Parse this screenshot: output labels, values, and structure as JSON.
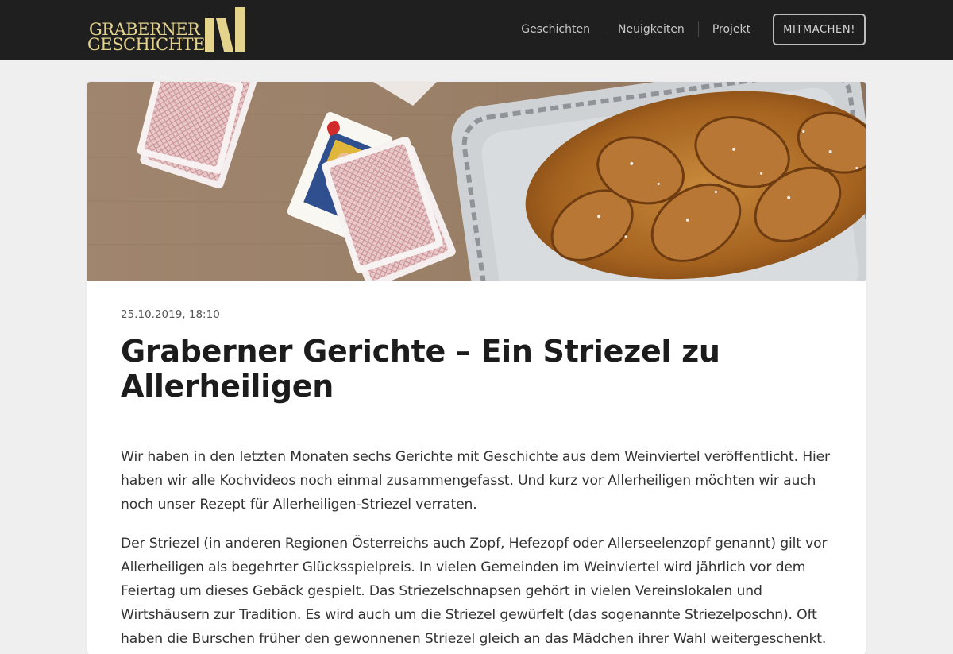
{
  "brand": {
    "line1": "GRABERNER",
    "line2": "GESCHICHTE",
    "color": "#e4d38c"
  },
  "nav": {
    "items": [
      {
        "label": "Geschichten"
      },
      {
        "label": "Neuigkeiten"
      },
      {
        "label": "Projekt"
      }
    ],
    "cta_label": "MITMACHEN!"
  },
  "article": {
    "date": "25.10.2019, 18:10",
    "title": "Graberner Gerichte – Ein Striezel zu Allerheiligen",
    "paragraphs": [
      "Wir haben in den letzten Monaten sechs Gerichte mit Geschichte aus dem Weinviertel veröffentlicht. Hier haben wir alle Kochvideos noch einmal zusammengefasst. Und kurz vor Allerheiligen möchten wir auch noch unser Rezept für Allerheiligen-Striezel verraten.",
      "Der Striezel (in anderen Regionen Österreichs auch Zopf, Hefezopf oder Allerseelenzopf genannt) gilt vor Allerheiligen als begehrter Glücksspielpreis. In vielen Gemeinden im Weinviertel wird jährlich vor dem Feiertag um dieses Gebäck gespielt. Das Striezelschnapsen gehört in vielen Vereinslokalen und Wirtshäusern zur Tradition. Es wird auch um die Striezel gewürfelt (das sogenannte Striezelposchn). Oft haben die Burschen früher den gewonnenen Striezel gleich an das Mädchen ihrer Wahl weitergeschenkt."
    ]
  },
  "colors": {
    "header_bg": "#1f1f1f",
    "page_bg": "#efefef",
    "card_bg": "#ffffff"
  }
}
